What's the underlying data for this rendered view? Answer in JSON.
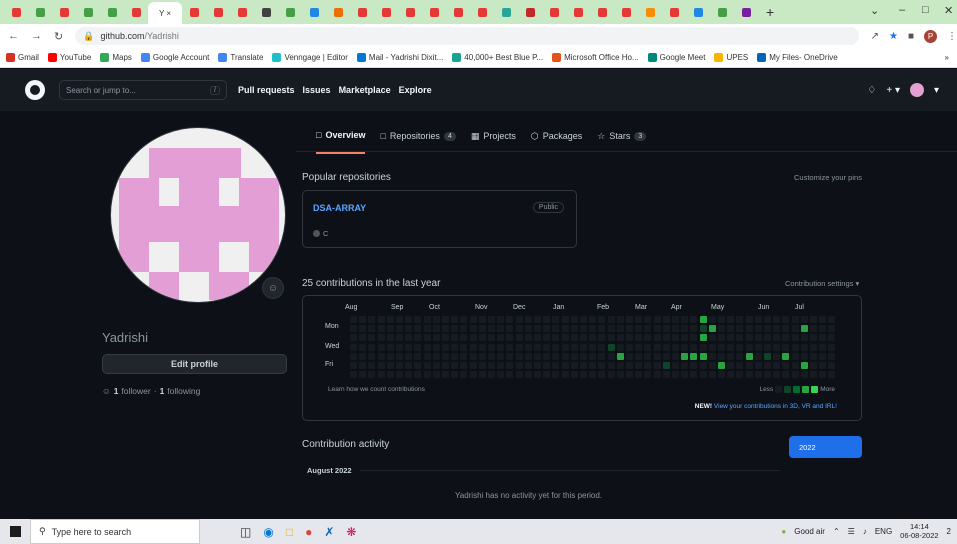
{
  "browser": {
    "tab_labels": [
      "Y",
      "×"
    ],
    "new_tab": "+",
    "url_domain": "github.com",
    "url_path": "/Yadrishi",
    "bookmarks": [
      {
        "label": "Gmail",
        "color": "#d93025"
      },
      {
        "label": "YouTube",
        "color": "#ff0000"
      },
      {
        "label": "Maps",
        "color": "#34a853"
      },
      {
        "label": "Google Account",
        "color": "#4285f4"
      },
      {
        "label": "Translate",
        "color": "#4285f4"
      },
      {
        "label": "Venngage | Editor",
        "color": "#1dbfc9"
      },
      {
        "label": "Mail - Yadrishi Dixit...",
        "color": "#0078d4"
      },
      {
        "label": "40,000+ Best Blue P...",
        "color": "#18a58d"
      },
      {
        "label": "Microsoft Office Ho...",
        "color": "#e3541b"
      },
      {
        "label": "Google Meet",
        "color": "#00897b"
      },
      {
        "label": "UPES",
        "color": "#f7b500"
      },
      {
        "label": "My Files- OneDrive",
        "color": "#0364b8"
      }
    ],
    "bookmarks_more": "»",
    "profile_initial": "P"
  },
  "github": {
    "search_placeholder": "Search or jump to...",
    "search_shortcut": "/",
    "nav": [
      "Pull requests",
      "Issues",
      "Marketplace",
      "Explore"
    ],
    "header_bell": "🔔",
    "header_plus": "+ ▾",
    "avatar_caret": "▾"
  },
  "tabs": [
    {
      "label": "Overview",
      "icon": "book-icon",
      "glyph": "□",
      "count": ""
    },
    {
      "label": "Repositories",
      "icon": "repo-icon",
      "glyph": "□",
      "count": "4"
    },
    {
      "label": "Projects",
      "icon": "table-icon",
      "glyph": "▦",
      "count": ""
    },
    {
      "label": "Packages",
      "icon": "package-icon",
      "glyph": "⬡",
      "count": ""
    },
    {
      "label": "Stars",
      "icon": "star-icon",
      "glyph": "☆",
      "count": "3"
    }
  ],
  "profile": {
    "username": "Yadrishi",
    "edit_label": "Edit profile",
    "followers_count": "1",
    "followers_label": "follower",
    "separator": "·",
    "following_count": "1",
    "following_label": "following",
    "status_glyph": "☺"
  },
  "popular": {
    "title": "Popular repositories",
    "customize": "Customize your pins",
    "repo_name": "DSA-ARRAY",
    "repo_visibility": "Public",
    "repo_language": "C"
  },
  "contributions": {
    "title": "25 contributions in the last year",
    "settings": "Contribution settings ▾",
    "months": [
      "Aug",
      "Sep",
      "Oct",
      "Nov",
      "Dec",
      "Jan",
      "Feb",
      "Mar",
      "Apr",
      "May",
      "Jun",
      "Jul"
    ],
    "days": [
      "Mon",
      "Wed",
      "Fri"
    ],
    "learn": "Learn how we count contributions",
    "less": "Less",
    "more": "More",
    "new_badge": "NEW!",
    "new_text": "View your contributions in 3D, VR and IRL!",
    "colors": [
      "#161b22",
      "#0e4429",
      "#006d32",
      "#26a641",
      "#39d353"
    ]
  },
  "activity": {
    "title": "Contribution activity",
    "year": "2022",
    "month": "August 2022",
    "empty": "Yadrishi has no activity yet for this period."
  },
  "taskbar": {
    "search": "Type here to search",
    "weather": "Good air",
    "lang": "ENG",
    "time": "14:14",
    "date": "06-08-2022",
    "notif": "2"
  }
}
